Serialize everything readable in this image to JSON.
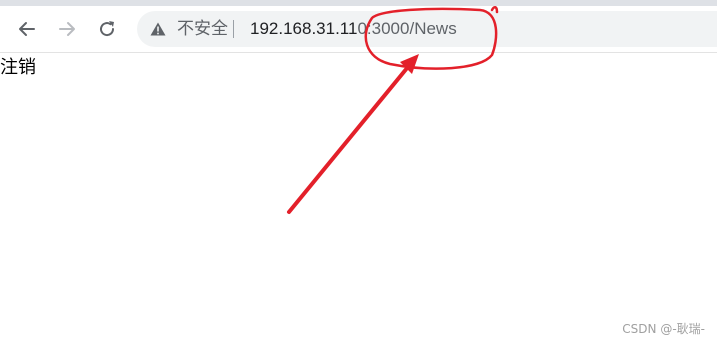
{
  "browser": {
    "security_label": "不安全",
    "url_host": "192.168.31.11",
    "url_rest": "0:3000/News",
    "annotation_color": "#e3202a"
  },
  "page": {
    "logout_link": "注销"
  },
  "watermark": "CSDN @-耿瑞-"
}
